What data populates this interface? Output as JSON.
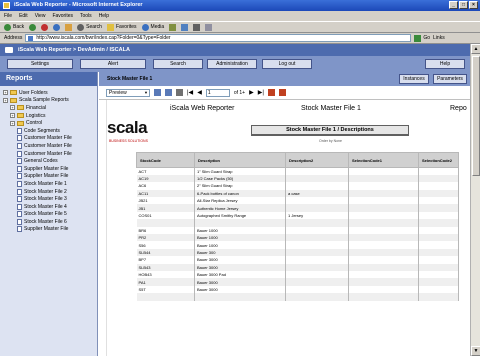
{
  "browser": {
    "title": "iScala Web Reporter - Microsoft Internet Explorer",
    "menu": [
      "File",
      "Edit",
      "View",
      "Favorites",
      "Tools",
      "Help"
    ],
    "toolbar": {
      "back": "Back",
      "search": "Search",
      "favorites": "Favorites",
      "media": "Media"
    },
    "address_label": "Address",
    "address": "http://www.iscala.com/bwr/index.cap?Folder=0&Type=Folder",
    "go": "Go",
    "links": "Links"
  },
  "app": {
    "header": "iScala Web Reporter > DevAdmin / ISCALA",
    "nav": {
      "settings": "Settings",
      "alert": "Alert",
      "search": "Search",
      "administration": "Administration",
      "logout": "Log out",
      "help": "Help"
    }
  },
  "sidebar": {
    "title": "Reports",
    "items": [
      {
        "label": "User Folders",
        "level": 0,
        "type": "folder"
      },
      {
        "label": "Scala Sample Reports",
        "level": 0,
        "type": "folder"
      },
      {
        "label": "Financial",
        "level": 1,
        "type": "folder"
      },
      {
        "label": "Logistics",
        "level": 1,
        "type": "folder"
      },
      {
        "label": "Control",
        "level": 1,
        "type": "folder"
      },
      {
        "label": "Code Segments",
        "level": 2,
        "type": "doc"
      },
      {
        "label": "Customer Master File",
        "level": 2,
        "type": "doc"
      },
      {
        "label": "Customer Master File",
        "level": 2,
        "type": "doc"
      },
      {
        "label": "Customer Master File",
        "level": 2,
        "type": "doc"
      },
      {
        "label": "General Codes",
        "level": 2,
        "type": "doc"
      },
      {
        "label": "Supplier Master File",
        "level": 2,
        "type": "doc"
      },
      {
        "label": "Supplier Master File",
        "level": 2,
        "type": "doc"
      },
      {
        "label": "Stock Master File 1",
        "level": 2,
        "type": "doc"
      },
      {
        "label": "Stock Master File 2",
        "level": 2,
        "type": "doc"
      },
      {
        "label": "Stock Master File 3",
        "level": 2,
        "type": "doc"
      },
      {
        "label": "Stock Master File 4",
        "level": 2,
        "type": "doc"
      },
      {
        "label": "Stock Master File 5",
        "level": 2,
        "type": "doc"
      },
      {
        "label": "Stock Master File 6",
        "level": 2,
        "type": "doc"
      },
      {
        "label": "Supplier Master File",
        "level": 2,
        "type": "doc"
      }
    ]
  },
  "content": {
    "title": "Stock Master File 1",
    "instances_btn": "Instances",
    "parameters_btn": "Parameters",
    "view_mode": "Preview",
    "page_input": "1",
    "page_total": "of 1+"
  },
  "report": {
    "app_name": "iScala Web Reporter",
    "name": "Stock Master File 1",
    "trail": "Repo",
    "logo": "scala",
    "tagline": "BUSINESS SOLUTIONS",
    "section_title": "Stock Master File 1 / Descriptions",
    "order_by": "Order by None",
    "columns": [
      "StockCode",
      "Description",
      "Description2",
      "SelectionCode1",
      "SelectionCode2"
    ],
    "rows": [
      [
        "ACT",
        "1\" Slim Guard Strap",
        "",
        "",
        ""
      ],
      [
        "AC19",
        "1/2 Case Packs (50)",
        "",
        "",
        ""
      ],
      [
        "AC6",
        "2\" Slim Guard Strap",
        "",
        "",
        ""
      ],
      [
        "AC11",
        "6-Pack bottles of canon",
        "a case",
        "",
        ""
      ],
      [
        "JB21",
        "All-Star Replica Jersey",
        "",
        "",
        ""
      ],
      [
        "JB1",
        "Authentic Home Jersey",
        "",
        "",
        ""
      ],
      [
        "COS01",
        "Autographed Smithy Range",
        "1 Jersey",
        "",
        ""
      ],
      [
        "",
        "",
        "",
        "",
        ""
      ],
      [
        "BR6",
        "Bauer 1000",
        "",
        "",
        ""
      ],
      [
        "PR2",
        "Bauer 1000",
        "",
        "",
        ""
      ],
      [
        "S56",
        "Bauer 1000",
        "",
        "",
        ""
      ],
      [
        "SLB44",
        "Bauer 300",
        "",
        "",
        ""
      ],
      [
        "BP7",
        "Bauer 3000",
        "",
        "",
        ""
      ],
      [
        "SLB43",
        "Bauer 3000",
        "",
        "",
        ""
      ],
      [
        "HOB43",
        "Bauer 3000 Pad",
        "",
        "",
        ""
      ],
      [
        "PA1",
        "Bauer 3000",
        "",
        "",
        ""
      ],
      [
        "S5T",
        "Bauer 3000",
        "",
        "",
        ""
      ],
      [
        "",
        "",
        "",
        "",
        ""
      ]
    ]
  }
}
